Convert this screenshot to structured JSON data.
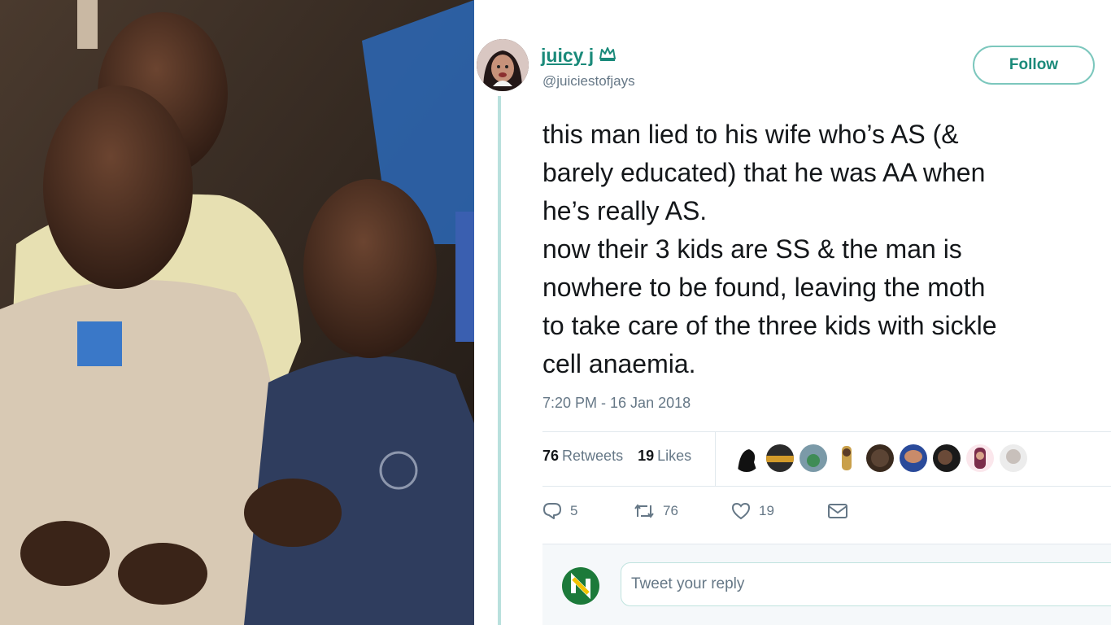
{
  "tweet": {
    "display_name": "juicy j",
    "name_icon": "crown-icon",
    "handle": "@juiciestofjays",
    "follow_label": "Follow",
    "body_lines": [
      "this man lied to his wife who’s AS (&",
      "barely educated) that he was AA when",
      "he’s really AS.",
      "now their 3 kids are SS & the man is",
      "nowhere to be found, leaving the moth",
      "to take care of the three kids with sickle",
      "cell anaemia."
    ],
    "timestamp": "7:20 PM - 16 Jan 2018",
    "retweets_count": "76",
    "retweets_label": "Retweets",
    "likes_count": "19",
    "likes_label": "Likes",
    "actions": {
      "reply_count": "5",
      "retweet_count": "76",
      "like_count": "19",
      "reply_icon": "reply-icon",
      "retweet_icon": "retweet-icon",
      "like_icon": "heart-icon",
      "dm_icon": "envelope-icon"
    },
    "reply_placeholder": "Tweet your reply",
    "colors": {
      "accent": "#1a8a7a",
      "thread_line": "#b9e0dd",
      "follow_border": "#7cc7bd"
    }
  }
}
